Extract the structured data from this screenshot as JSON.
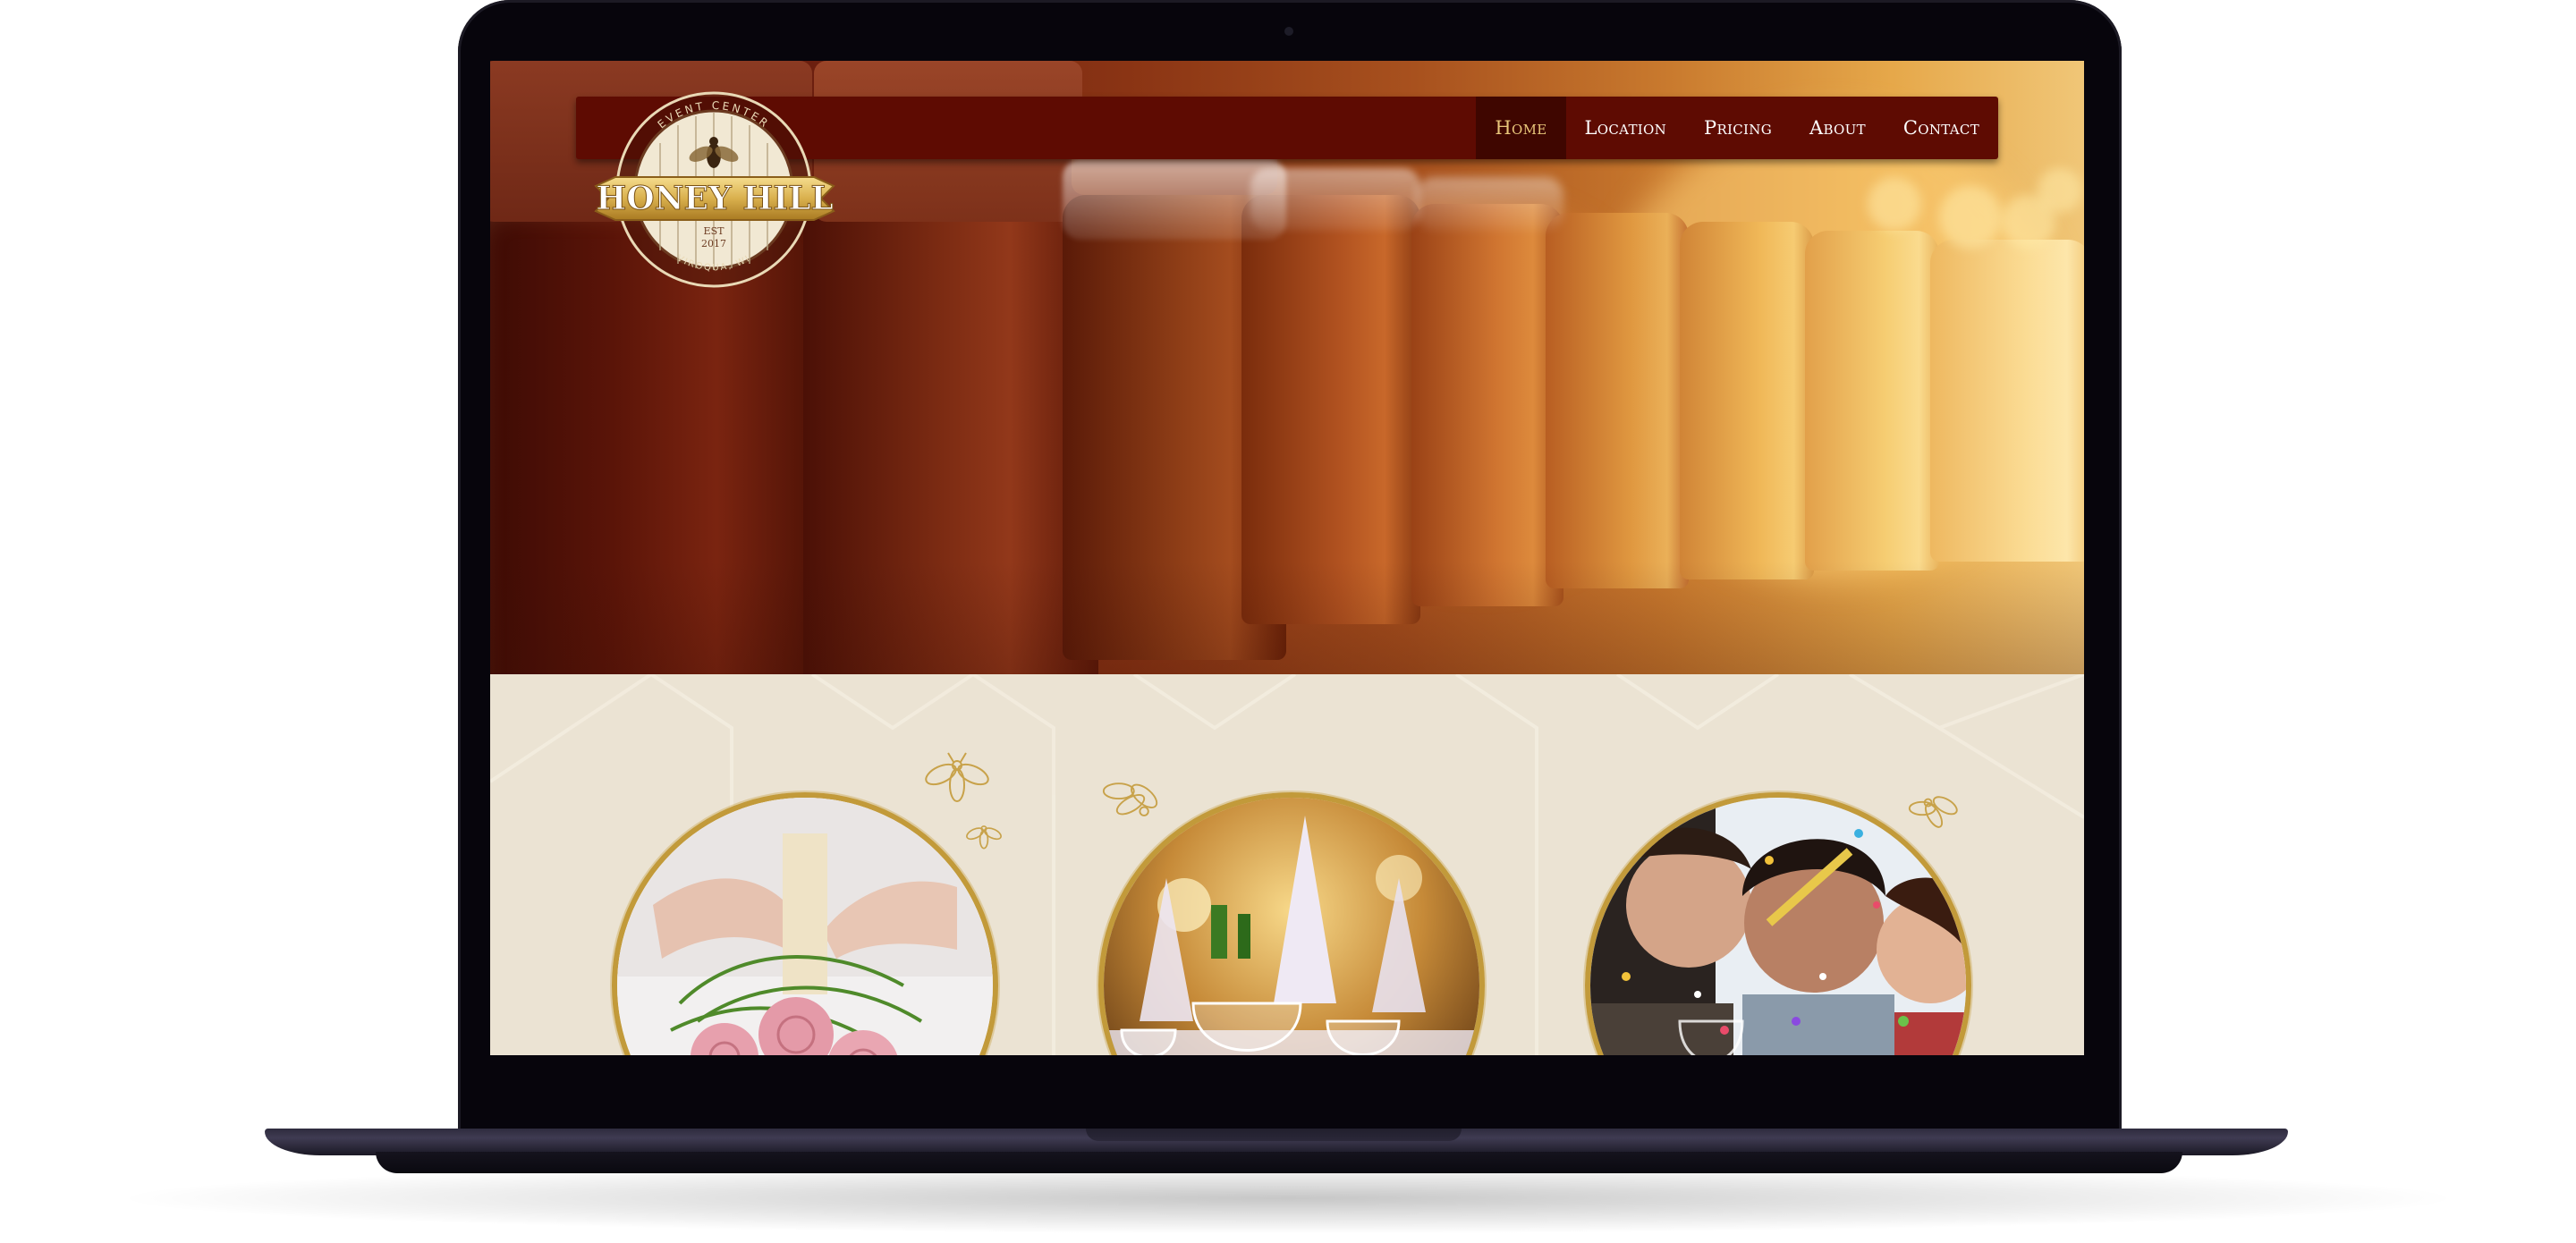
{
  "site": {
    "logo": {
      "top_text": "EVENT CENTER",
      "name": "HONEY HILL",
      "est": "EST",
      "year": "2017",
      "bottom_text": "VIROQUA, WI"
    },
    "nav": {
      "items": [
        {
          "label": "Home",
          "active": true
        },
        {
          "label": "Location",
          "active": false
        },
        {
          "label": "Pricing",
          "active": false
        },
        {
          "label": "About",
          "active": false
        },
        {
          "label": "Contact",
          "active": false
        }
      ]
    },
    "hero": {
      "image": "honey-jars-photo"
    },
    "features": [
      {
        "image": "bridal-bouquet-photo"
      },
      {
        "image": "table-setting-photo"
      },
      {
        "image": "party-confetti-photo"
      }
    ]
  },
  "colors": {
    "nav_bg": "#5e0b02",
    "nav_active_bg": "#3f0600",
    "nav_active_text": "#e9c67a",
    "gold": "#c29a3a",
    "cream": "#ebe3d3",
    "device": "#07050c"
  }
}
